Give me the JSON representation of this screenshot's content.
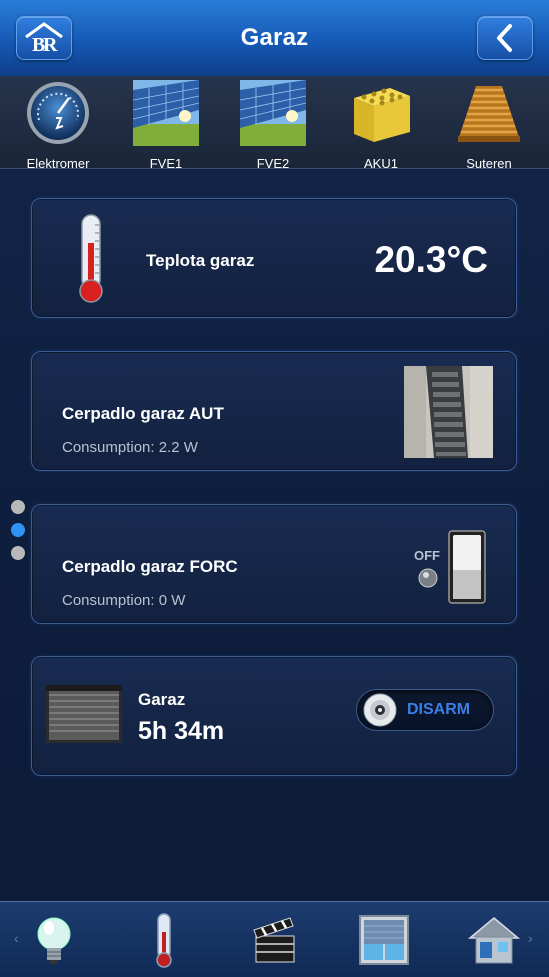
{
  "header": {
    "title": "Garaz"
  },
  "rooms": [
    {
      "label": "Elektromer",
      "icon": "power-meter-icon"
    },
    {
      "label": "FVE1",
      "icon": "solar-panel-icon"
    },
    {
      "label": "FVE2",
      "icon": "solar-panel-icon"
    },
    {
      "label": "AKU1",
      "icon": "battery-pack-icon"
    },
    {
      "label": "Suteren",
      "icon": "stairs-icon"
    }
  ],
  "cards": {
    "temperature": {
      "name": "Teplota garaz",
      "value": "20.3°C"
    },
    "pump_aut": {
      "name": "Cerpadlo garaz AUT",
      "consumption": "Consumption: 2.2 W"
    },
    "pump_forc": {
      "name": "Cerpadlo garaz FORC",
      "consumption": "Consumption: 0 W",
      "state": "OFF"
    },
    "door": {
      "name": "Garaz",
      "time": "5h 34m",
      "action": "DISARM"
    }
  },
  "pager": {
    "pages": 3,
    "active": 2
  },
  "colors": {
    "accent": "#2e93f2",
    "header": "#1559b5",
    "disarm_text": "#3b7fe6"
  },
  "bottom_nav": [
    "light-bulb-icon",
    "thermometer-icon",
    "clapperboard-icon",
    "window-blinds-icon",
    "house-icon"
  ]
}
